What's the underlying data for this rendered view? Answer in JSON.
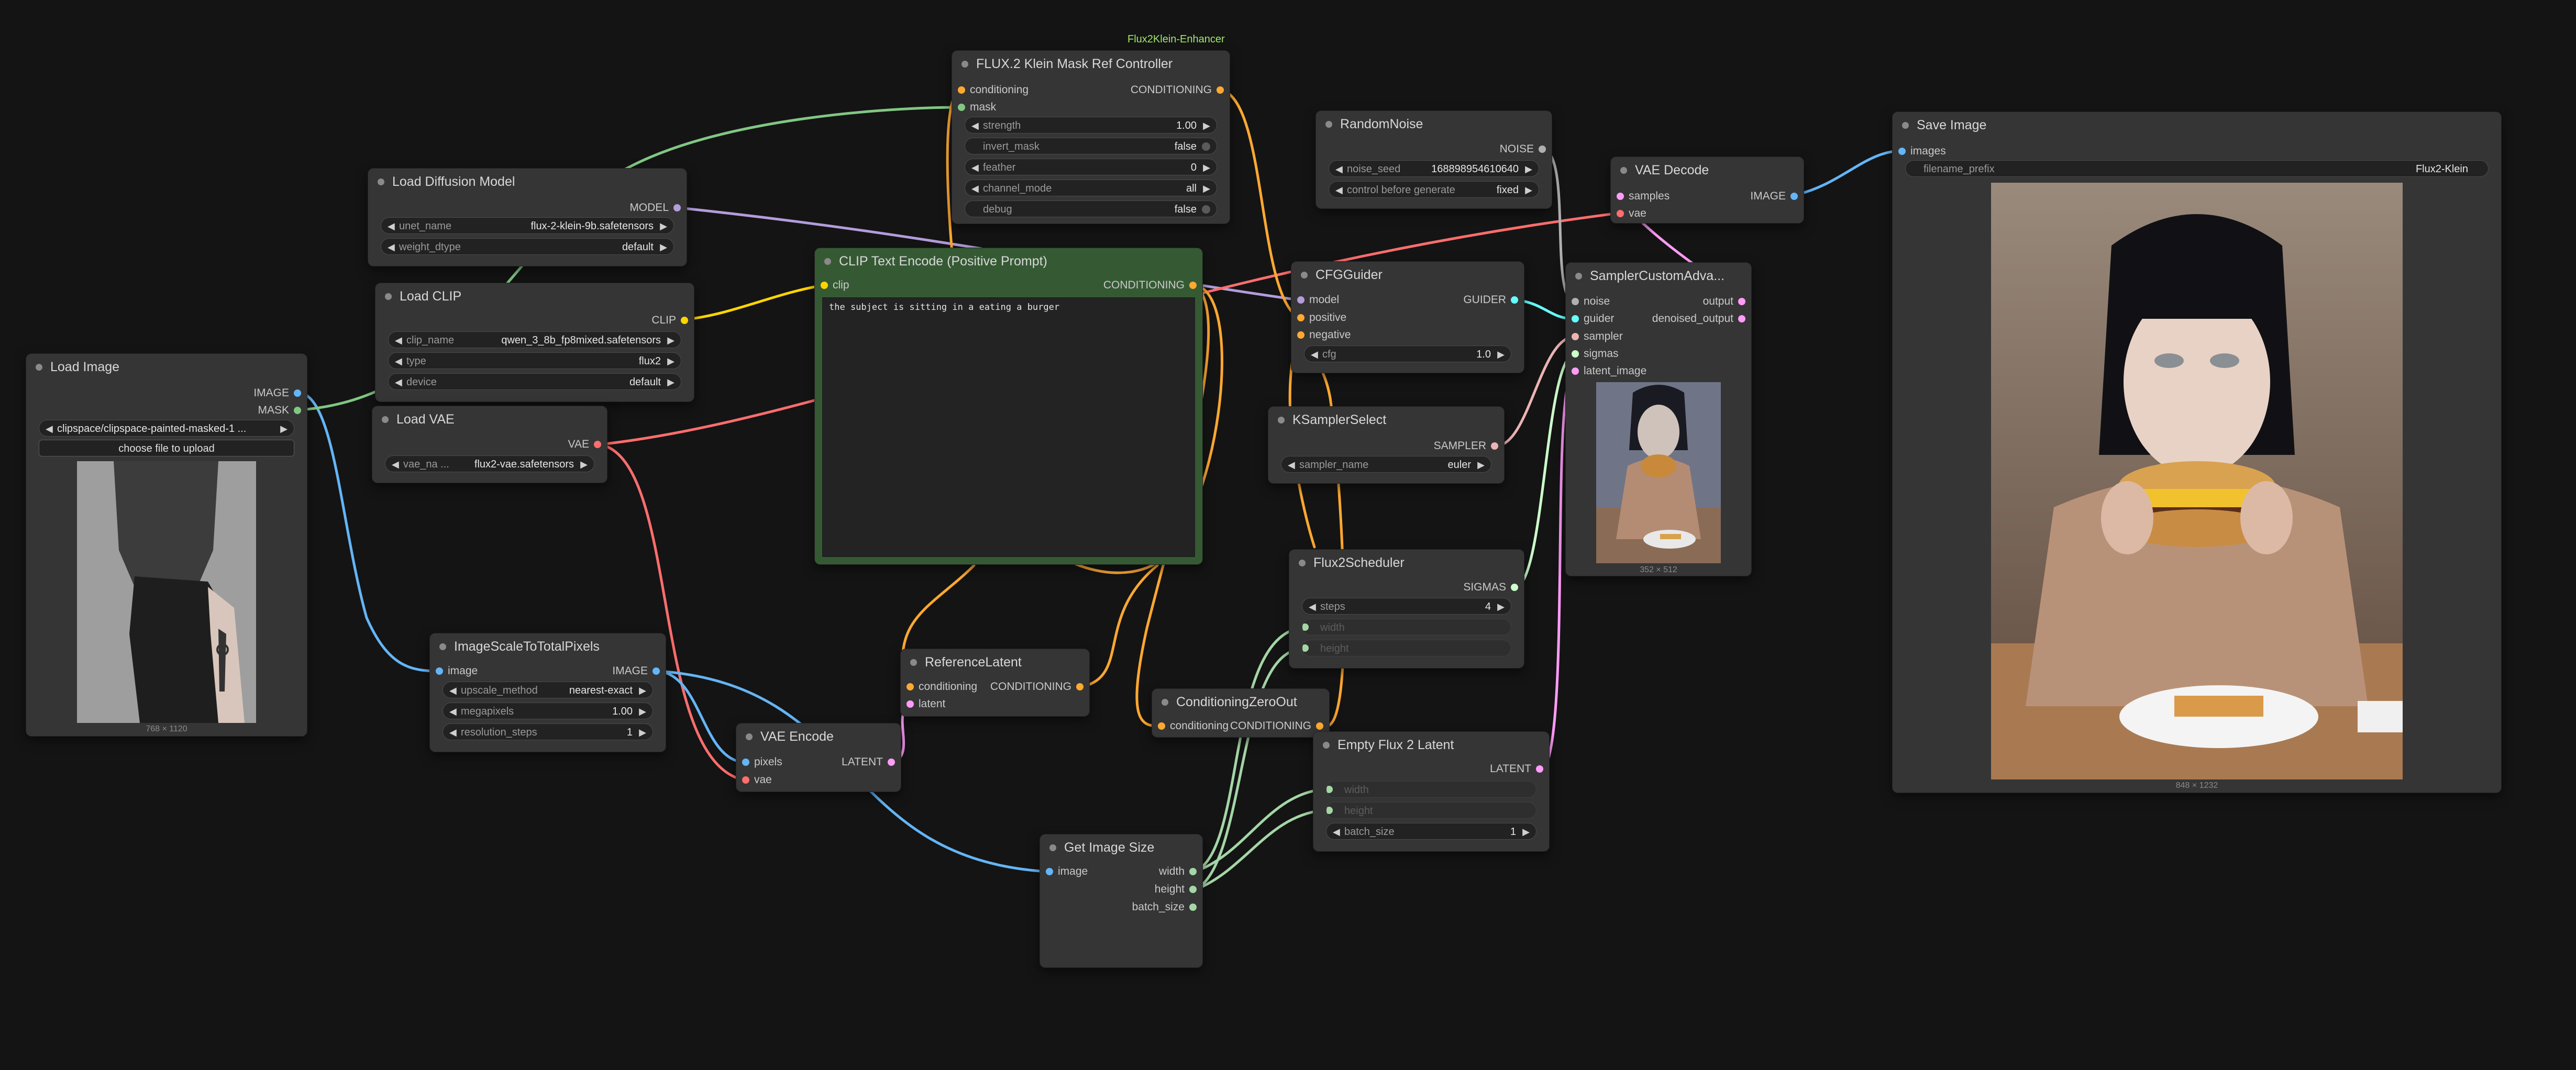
{
  "colors": {
    "background": "#141414",
    "node": "#353535",
    "green_node": "#355a33",
    "port_image": "#64b5f6",
    "port_mask": "#81c784",
    "port_model": "#b39ddb",
    "port_clip": "#ffd500",
    "port_vae": "#ff6e6e",
    "port_conditioning": "#ffa931",
    "port_latent": "#ff9cf9",
    "port_noise": "#b0b0b0",
    "port_guider": "#66ffff",
    "port_sampler": "#ecb4b4",
    "port_sigmas": "#cdffcd",
    "port_int": "#a5d6a7"
  },
  "group_label": "Flux2Klein-Enhancer",
  "nodes": {
    "load_image": {
      "title": "Load Image",
      "outputs": [
        "IMAGE",
        "MASK"
      ],
      "image_value": "clipspace/clipspace-painted-masked-1 ...",
      "upload_label": "choose file to upload",
      "caption": "768 × 1120"
    },
    "load_diffusion": {
      "title": "Load Diffusion Model",
      "output": "MODEL",
      "widgets": [
        {
          "label": "unet_name",
          "value": "flux-2-klein-9b.safetensors"
        },
        {
          "label": "weight_dtype",
          "value": "default"
        }
      ]
    },
    "load_clip": {
      "title": "Load CLIP",
      "output": "CLIP",
      "widgets": [
        {
          "label": "clip_name",
          "value": "qwen_3_8b_fp8mixed.safetensors"
        },
        {
          "label": "type",
          "value": "flux2"
        },
        {
          "label": "device",
          "value": "default"
        }
      ]
    },
    "load_vae": {
      "title": "Load VAE",
      "output": "VAE",
      "widget": {
        "label": "vae_na ...",
        "value": "flux2-vae.safetensors"
      }
    },
    "scale": {
      "title": "ImageScaleToTotalPixels",
      "input": "image",
      "output": "IMAGE",
      "widgets": [
        {
          "label": "upscale_method",
          "value": "nearest-exact"
        },
        {
          "label": "megapixels",
          "value": "1.00"
        },
        {
          "label": "resolution_steps",
          "value": "1"
        }
      ]
    },
    "vae_encode": {
      "title": "VAE Encode",
      "inputs": [
        "pixels",
        "vae"
      ],
      "output": "LATENT"
    },
    "klein": {
      "title": "FLUX.2 Klein Mask Ref Controller",
      "inputs": [
        "conditioning",
        "mask"
      ],
      "output": "CONDITIONING",
      "widgets": [
        {
          "label": "strength",
          "value": "1.00"
        },
        {
          "label": "invert_mask",
          "value": "false"
        },
        {
          "label": "feather",
          "value": "0"
        },
        {
          "label": "channel_mode",
          "value": "all"
        },
        {
          "label": "debug",
          "value": "false"
        }
      ]
    },
    "clip_text": {
      "title": "CLIP Text Encode (Positive Prompt)",
      "input": "clip",
      "output": "CONDITIONING",
      "prompt": "the subject is sitting in a eating a burger"
    },
    "ref_latent": {
      "title": "ReferenceLatent",
      "inputs": [
        "conditioning",
        "latent"
      ],
      "output": "CONDITIONING"
    },
    "get_size": {
      "title": "Get Image Size",
      "input": "image",
      "outputs": [
        "width",
        "height",
        "batch_size"
      ]
    },
    "cond_zero": {
      "title": "ConditioningZeroOut",
      "input": "conditioning",
      "output": "CONDITIONING"
    },
    "random_noise": {
      "title": "RandomNoise",
      "output": "NOISE",
      "widgets": [
        {
          "label": "noise_seed",
          "value": "168898954610640"
        },
        {
          "label": "control before generate",
          "value": "fixed"
        }
      ]
    },
    "cfg_guider": {
      "title": "CFGGuider",
      "inputs": [
        "model",
        "positive",
        "negative"
      ],
      "output": "GUIDER",
      "widget": {
        "label": "cfg",
        "value": "1.0"
      }
    },
    "ksampler_select": {
      "title": "KSamplerSelect",
      "output": "SAMPLER",
      "widget": {
        "label": "sampler_name",
        "value": "euler"
      }
    },
    "flux2_scheduler": {
      "title": "Flux2Scheduler",
      "output": "SIGMAS",
      "widgets": [
        {
          "label": "steps",
          "value": "4"
        },
        {
          "label": "width",
          "value": ""
        },
        {
          "label": "height",
          "value": ""
        }
      ]
    },
    "empty_latent": {
      "title": "Empty Flux 2 Latent",
      "output": "LATENT",
      "widgets": [
        {
          "label": "width",
          "value": ""
        },
        {
          "label": "height",
          "value": ""
        },
        {
          "label": "batch_size",
          "value": "1"
        }
      ]
    },
    "vae_decode": {
      "title": "VAE Decode",
      "inputs": [
        "samples",
        "vae"
      ],
      "output": "IMAGE"
    },
    "sampler_adv": {
      "title": "SamplerCustomAdva...",
      "inputs": [
        "noise",
        "guider",
        "sampler",
        "sigmas",
        "latent_image"
      ],
      "outputs": [
        "output",
        "denoised_output"
      ],
      "caption": "352 × 512"
    },
    "save_image": {
      "title": "Save Image",
      "input": "images",
      "widget": {
        "label": "filename_prefix",
        "value": "Flux2-Klein"
      },
      "caption": "848 × 1232"
    }
  }
}
